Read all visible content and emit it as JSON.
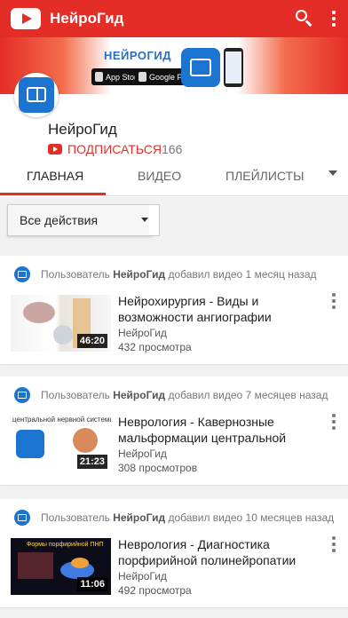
{
  "app_bar": {
    "title": "НейроГид",
    "color": "#e52d27"
  },
  "banner": {
    "title": "НЕЙРОГИД",
    "app_store": "App Store",
    "google_play": "Google Play"
  },
  "channel": {
    "name": "НейроГид",
    "subscribe_label": "ПОДПИСАТЬСЯ",
    "subscriber_count": "166"
  },
  "tabs": [
    {
      "label": "ГЛАВНАЯ",
      "active": true
    },
    {
      "label": "ВИДЕО",
      "active": false
    },
    {
      "label": "ПЛЕЙЛИСТЫ",
      "active": false
    }
  ],
  "filter": {
    "selected": "Все действия"
  },
  "feed": [
    {
      "activity_prefix": "Пользователь",
      "activity_user": "НейроГид",
      "activity_suffix": "добавил видео 1 месяц назад",
      "title": "Нейрохирургия - Виды и возможности ангиографии",
      "channel": "НейроГид",
      "views": "432 просмотра",
      "duration": "46:20",
      "thumb_text": ""
    },
    {
      "activity_prefix": "Пользователь",
      "activity_user": "НейроГид",
      "activity_suffix": "добавил видео 7 месяцев назад",
      "title": "Неврология - Кавернозные мальформации центральной",
      "channel": "НейроГид",
      "views": "308 просмотров",
      "duration": "21:23",
      "thumb_text": "центральной нервной системы"
    },
    {
      "activity_prefix": "Пользователь",
      "activity_user": "НейроГид",
      "activity_suffix": "добавил видео 10 месяцев назад",
      "title": "Неврология - Диагностика порфирийной полинейропатии",
      "channel": "НейроГид",
      "views": "492 просмотра",
      "duration": "11:06",
      "thumb_text": "Формы порфирийной ПНП"
    }
  ]
}
